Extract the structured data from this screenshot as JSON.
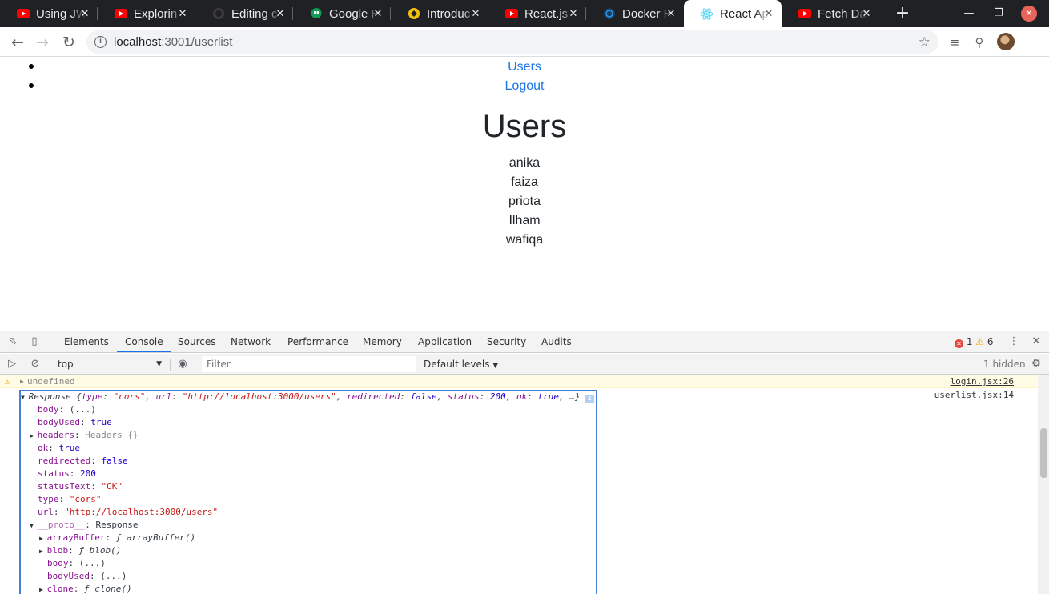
{
  "browser": {
    "tabs": [
      {
        "title": "Using JW",
        "icon": "youtube-icon",
        "active": false
      },
      {
        "title": "Explorin",
        "icon": "youtube-icon",
        "active": false
      },
      {
        "title": "Editing c",
        "icon": "github-icon",
        "active": false
      },
      {
        "title": "Google H",
        "icon": "google-hangouts-icon",
        "active": false
      },
      {
        "title": "Introduc",
        "icon": "site-favicon-icon",
        "active": false
      },
      {
        "title": "React.js",
        "icon": "youtube-icon",
        "active": false
      },
      {
        "title": "Docker H",
        "icon": "docker-icon",
        "active": false
      },
      {
        "title": "React Ap",
        "icon": "react-icon",
        "active": true
      },
      {
        "title": "Fetch Da",
        "icon": "youtube-icon",
        "active": false
      }
    ],
    "url_host": "localhost",
    "url_rest": ":3001/userlist",
    "colors": {
      "tabbar": "#202124",
      "youtube": "#ff0000",
      "react": "#61dafb",
      "link": "#1a73e8"
    }
  },
  "page": {
    "nav": [
      "Users",
      "Logout"
    ],
    "title": "Users",
    "users": [
      "anika",
      "faiza",
      "priota",
      "Ilham",
      "wafiqa"
    ]
  },
  "devtools": {
    "tabs": [
      "Elements",
      "Console",
      "Sources",
      "Network",
      "Performance",
      "Memory",
      "Application",
      "Security",
      "Audits"
    ],
    "active_tab": "Console",
    "error_count": "1",
    "warning_count": "6",
    "context": "top",
    "filter_placeholder": "Filter",
    "levels": "Default levels",
    "hidden_count": "1 hidden",
    "warning_message": "undefined",
    "warning_source": "login.jsx:26",
    "log_source": "userlist.jsx:14",
    "response_summary": {
      "label": "Response",
      "open": "{",
      "type_key": "type",
      "type_val": "\"cors\"",
      "url_key": "url",
      "url_val": "\"http://localhost:3000/users\"",
      "redirected_key": "redirected",
      "redirected_val": "false",
      "status_key": "status",
      "status_val": "200",
      "ok_key": "ok",
      "ok_val": "true",
      "close": "…}"
    },
    "props": [
      {
        "key": "body",
        "val": "(...)",
        "kind": "plain"
      },
      {
        "key": "bodyUsed",
        "val": "true",
        "kind": "bool"
      },
      {
        "key": "headers",
        "val": "Headers {}",
        "kind": "obj"
      },
      {
        "key": "ok",
        "val": "true",
        "kind": "bool"
      },
      {
        "key": "redirected",
        "val": "false",
        "kind": "bool"
      },
      {
        "key": "status",
        "val": "200",
        "kind": "num"
      },
      {
        "key": "statusText",
        "val": "\"OK\"",
        "kind": "str"
      },
      {
        "key": "type",
        "val": "\"cors\"",
        "kind": "str"
      },
      {
        "key": "url",
        "val": "\"http://localhost:3000/users\"",
        "kind": "str"
      }
    ],
    "proto_key": "__proto__",
    "proto_val": "Response",
    "proto_props": [
      {
        "key": "arrayBuffer",
        "val": "ƒ arrayBuffer()"
      },
      {
        "key": "blob",
        "val": "ƒ blob()"
      },
      {
        "key": "body",
        "val": "(...)"
      },
      {
        "key": "bodyUsed",
        "val": "(...)"
      },
      {
        "key": "clone",
        "val": "ƒ clone()"
      }
    ]
  }
}
